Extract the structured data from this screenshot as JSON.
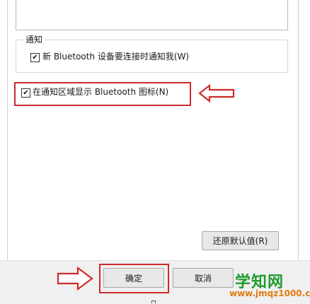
{
  "notification_group": {
    "title": "通知",
    "notify_new_device_label": "新 Bluetooth 设备要连接时通知我(W)",
    "notify_new_device_checked": true,
    "show_tray_icon_label": "在通知区域显示 Bluetooth 图标(N)",
    "show_tray_icon_checked": true
  },
  "buttons": {
    "restore_defaults": "还原默认值(R)",
    "ok": "确定",
    "cancel": "取消"
  },
  "icons": {
    "checkmark": "✔"
  },
  "colors": {
    "highlight": "#cf2a2a",
    "watermark_green": "#1f9b2e",
    "watermark_orange": "#e07a10"
  },
  "watermark": {
    "title": "学知网",
    "url": "www.jmqz1000.com"
  }
}
